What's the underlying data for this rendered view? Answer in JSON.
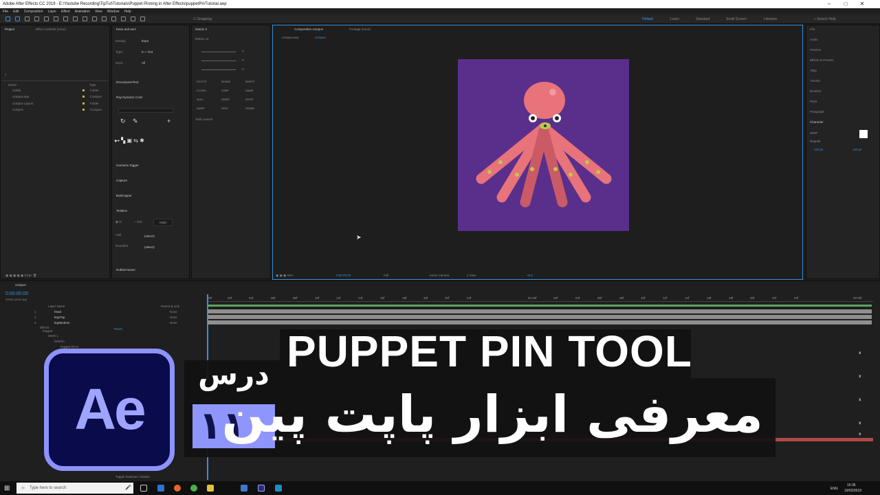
{
  "window": {
    "title": "Adobe After Effects CC 2019 - E:\\Youtube Recording\\TipTut\\Tutorials\\Puppet Pinning in After Effects\\puppetPinTutorial.aep"
  },
  "menu": [
    "File",
    "Edit",
    "Composition",
    "Layer",
    "Effect",
    "Animation",
    "View",
    "Window",
    "Help"
  ],
  "toolbar": {
    "snapping": "Snapping",
    "workspaces": [
      "Default",
      "Learn",
      "Standard",
      "Small Screen",
      "Libraries"
    ],
    "search": "Search Help"
  },
  "project": {
    "tab": "Project",
    "effects_tab": "Effect Controls (none)",
    "col_name": "Name",
    "col_type": "Type",
    "items": [
      {
        "name": "Solids",
        "type": "Folder"
      },
      {
        "name": "octopus.aep",
        "type": "Compos"
      },
      {
        "name": "octopus Layers",
        "type": "Folder"
      },
      {
        "name": "octopus",
        "type": "Compos"
      }
    ]
  },
  "ease": {
    "title": "Ease and wizz",
    "easing_label": "Easing:",
    "easing": "Expo",
    "type_label": "Type:",
    "type": "In + Out",
    "keys_label": "Keys:",
    "keys": "All"
  },
  "panels": {
    "decompose": "DecomposeText",
    "ray": "Ray Dynamic Color",
    "isometric": "Isometric Rigger",
    "capture": "Capture",
    "buttcapper": "ButtCapper",
    "textbox": "TextBox",
    "rubberhose": "RubberHose2"
  },
  "textbox": {
    "in": "In",
    "out": "Out",
    "apply": "Apply",
    "add": "Add",
    "add_val": "(select)",
    "round": "Round/In",
    "round_val": "(select)"
  },
  "motion": {
    "title": "Motion 2",
    "sub": "Motion v2",
    "buttons": [
      "EXCITE",
      "BLEND",
      "BURST",
      "CLONE",
      "JUMP",
      "NAME",
      "NULL",
      "ORBIT",
      "ROPE",
      "WARP",
      "SPIN",
      "STARE"
    ],
    "task": "Task Launch",
    "values": [
      "0",
      "0",
      "0"
    ]
  },
  "comp": {
    "tab": "Composition octopus",
    "footage": "Footage (none)",
    "crumb1": "octopus.aep",
    "crumb2": "octopus",
    "zoom": "50%",
    "time": "0:00:00:00",
    "res": "Full",
    "camera": "Active Camera",
    "view": "1 View",
    "exposure": "+0.0"
  },
  "right": {
    "panels": [
      "Info",
      "Audio",
      "Preview",
      "Effects & Presets",
      "Align",
      "Tracker",
      "Brushes",
      "Paint",
      "Paragraph",
      "Character"
    ],
    "font": "WWF",
    "style": "Regular",
    "size": "120 px",
    "leading": "140 px"
  },
  "timeline": {
    "tab": "octopus",
    "timecode": "0:00:00:00",
    "fps": "00000 (25.00 fps)",
    "col_layer": "Layer Name",
    "col_parent": "Parent & Link",
    "layers": [
      {
        "num": "1",
        "name": "head",
        "parent": "None"
      },
      {
        "num": "2",
        "name": "legsTop",
        "parent": "None"
      },
      {
        "num": "3",
        "name": "legsBottom",
        "parent": "None"
      }
    ],
    "props": [
      "Effects",
      "Puppet",
      "Mesh 1",
      "Deform",
      "Puppet Pin 8"
    ],
    "reset": "Reset",
    "toggle": "Toggle Switches / Modes",
    "ticks": [
      "00f",
      "02f",
      "04f",
      "06f",
      "08f",
      "10f",
      "12f",
      "14f",
      "16f",
      "18f",
      "20f",
      "22f",
      "24f",
      "01:00f",
      "02f",
      "04f",
      "06f",
      "08f",
      "10f",
      "12f",
      "14f",
      "16f",
      "18f",
      "20f",
      "22f",
      "24f",
      "02:00f"
    ]
  },
  "overlay": {
    "logo": "Ae",
    "title_en": "PUPPET PIN TOOL",
    "lesson": "درس",
    "number": "۱۱۰",
    "title_fa": "معرفی ابزار پاپت پین"
  },
  "taskbar": {
    "search": "Type here to search",
    "lang": "ENG",
    "time": "16:36",
    "date": "19/02/2019"
  },
  "colors": {
    "accent": "#3b8fd8",
    "comp_bg": "#5a2f8c",
    "octopus": "#e8737a",
    "logo_bg": "#0a0b4a",
    "logo_fg": "#9ea4ff"
  }
}
